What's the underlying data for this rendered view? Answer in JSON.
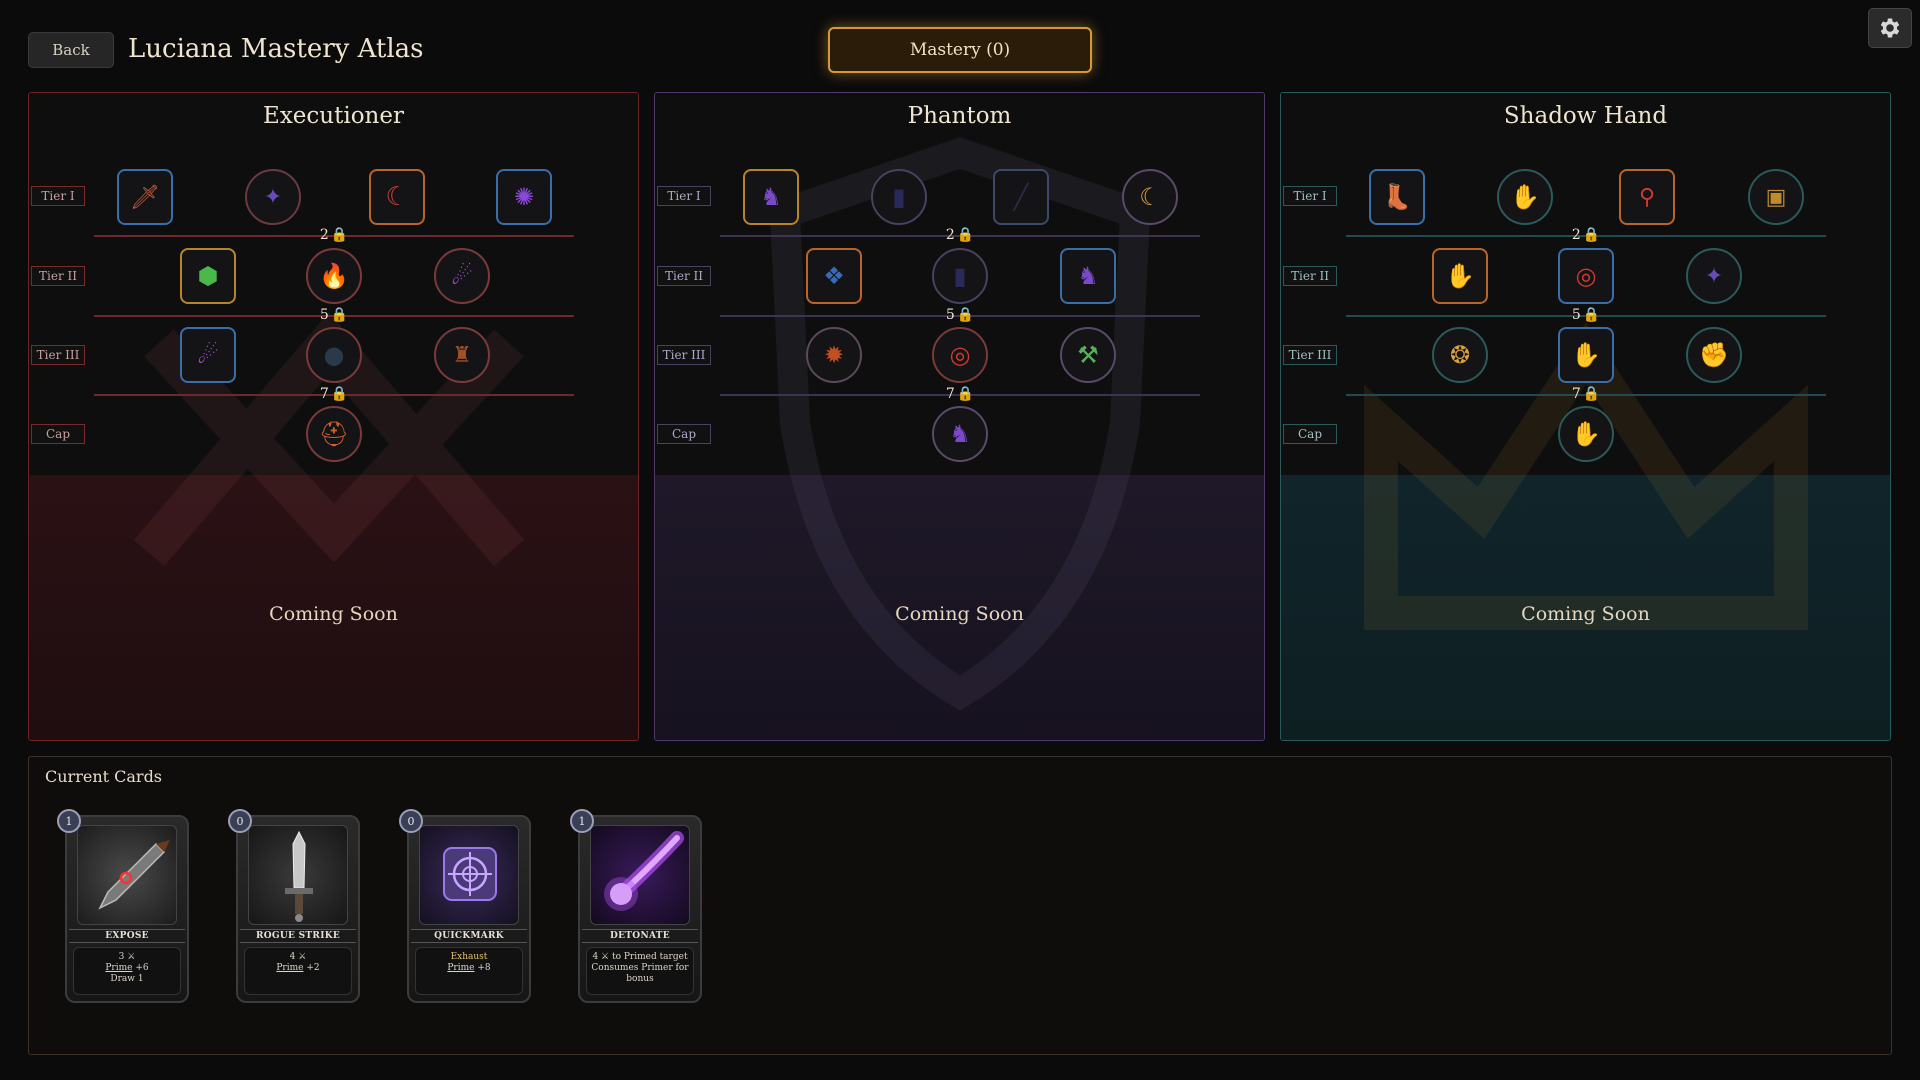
{
  "header": {
    "back_label": "Back",
    "title": "Luciana Mastery Atlas",
    "mastery_label": "Mastery (0)",
    "settings_icon": "gear-icon"
  },
  "tier_labels": [
    "Tier I",
    "Tier II",
    "Tier III",
    "Cap"
  ],
  "gates": [
    "2",
    "5",
    "7"
  ],
  "panels": [
    {
      "name": "Executioner",
      "coming_soon": "Coming Soon",
      "accent": "#8a2a2a"
    },
    {
      "name": "Phantom",
      "coming_soon": "Coming Soon",
      "accent": "#5a3a7a"
    },
    {
      "name": "Shadow Hand",
      "coming_soon": "Coming Soon",
      "accent": "#2a6a6a"
    }
  ],
  "current_cards": {
    "title": "Current Cards",
    "cards": [
      {
        "name": "Expose",
        "cost": "1",
        "line1": "3 ⚔",
        "line2a": "Prime",
        "line2b": " +6",
        "line3": "Draw 1",
        "icon": "dagger-icon"
      },
      {
        "name": "Rogue Strike",
        "cost": "0",
        "line1": "4 ⚔",
        "line2a": "Prime",
        "line2b": " +2",
        "line3": "",
        "icon": "sword-icon"
      },
      {
        "name": "Quickmark",
        "cost": "0",
        "line1": "Exhaust",
        "line2a": "Prime",
        "line2b": " +8",
        "line3": "",
        "icon": "target-icon"
      },
      {
        "name": "Detonate",
        "cost": "1",
        "line1": "4 ⚔ to Primed target",
        "line2a": "Consumes Primer for",
        "line2b": "",
        "line3": "bonus",
        "icon": "comet-icon"
      }
    ]
  }
}
